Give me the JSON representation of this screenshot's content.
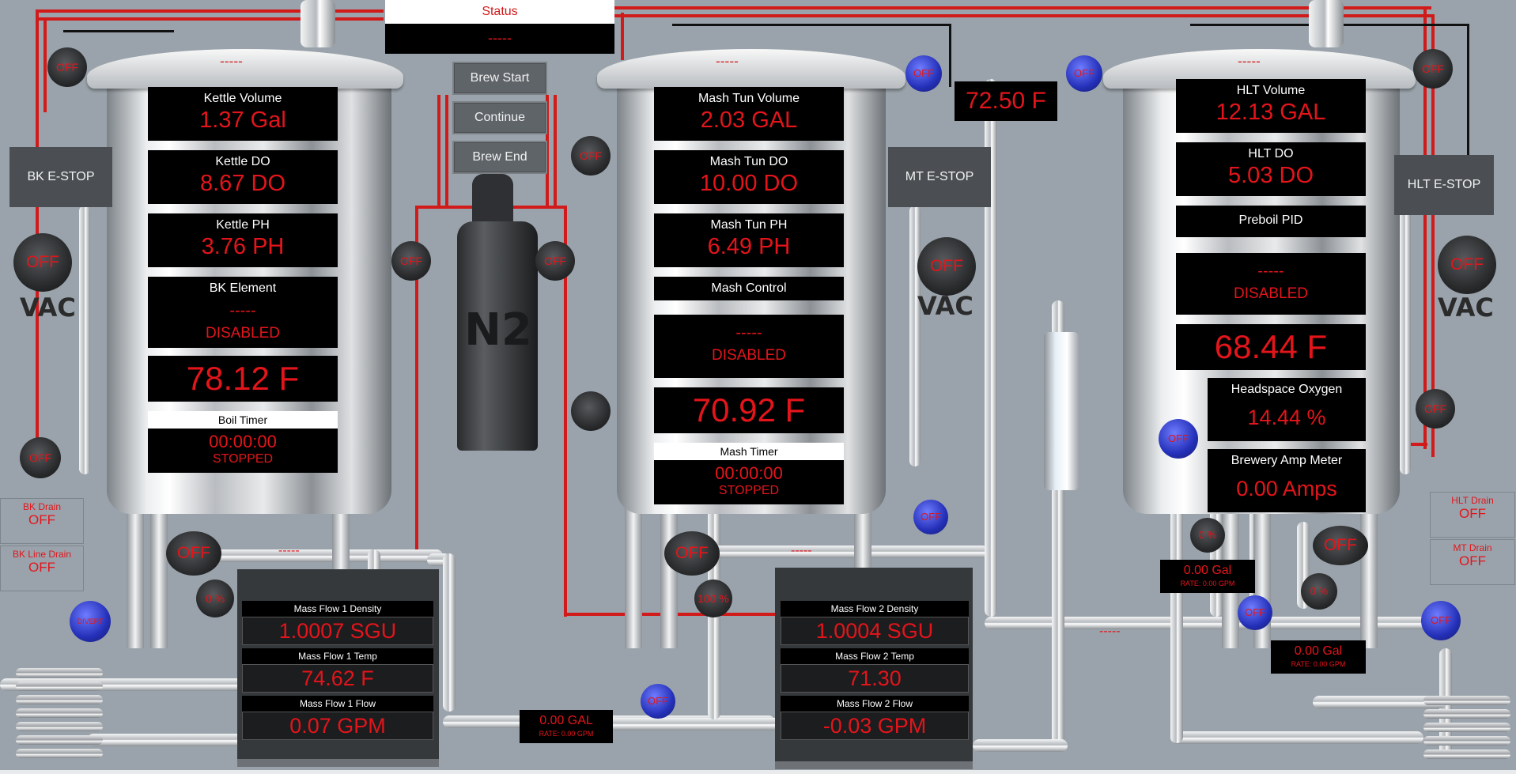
{
  "status": {
    "title": "Status",
    "value": "-----"
  },
  "controls": {
    "brew_start": "Brew Start",
    "continue": "Continue",
    "brew_end": "Brew End"
  },
  "n2_label": "N2",
  "kettle": {
    "lid_dash": "-----",
    "volume": {
      "label": "Kettle Volume",
      "value": "1.37 Gal"
    },
    "do": {
      "label": "Kettle DO",
      "value": "8.67 DO"
    },
    "ph": {
      "label": "Kettle  PH",
      "value": "3.76 PH"
    },
    "element": {
      "label": "BK Element",
      "dash": "-----",
      "state": "DISABLED"
    },
    "temp": "78.12 F",
    "timer": {
      "label": "Boil Timer",
      "time": "00:00:00",
      "state": "STOPPED"
    },
    "estop": "BK E-STOP",
    "outlet_dash": "-----"
  },
  "mash": {
    "lid_dash": "-----",
    "volume": {
      "label": "Mash Tun Volume",
      "value": "2.03 GAL"
    },
    "do": {
      "label": "Mash Tun DO",
      "value": "10.00 DO"
    },
    "ph": {
      "label": "Mash Tun PH",
      "value": "6.49 PH"
    },
    "control": {
      "label": "Mash Control",
      "dash": "-----",
      "state": "DISABLED"
    },
    "temp": "70.92 F",
    "timer": {
      "label": "Mash Timer",
      "time": "00:00:00",
      "state": "STOPPED"
    },
    "estop": "MT E-STOP",
    "outlet_dash": "-----"
  },
  "hlt": {
    "lid_dash": "-----",
    "volume": {
      "label": "HLT Volume",
      "value": "12.13 GAL"
    },
    "do": {
      "label": "HLT DO",
      "value": "5.03 DO"
    },
    "pid": {
      "label": "Preboil PID",
      "dash": "-----",
      "state": "DISABLED"
    },
    "temp": "68.44 F",
    "headspace": {
      "label": "Headspace Oxygen",
      "value": "14.44 %"
    },
    "amp": {
      "label": "Brewery Amp Meter",
      "value": "0.00 Amps"
    },
    "estop": "HLT E-STOP",
    "outlet_dash": "-----"
  },
  "transfer_temp": "72.50 F",
  "vac_label": "VAC",
  "off": "OFF",
  "pumps": {
    "bk_top": "OFF",
    "bk_vac": "OFF",
    "bk_bottom": "OFF",
    "bk_outlet": "OFF",
    "bk_pct": "0 %",
    "n2_left": "OFF",
    "n2_right": "OFF",
    "mt_left_top": "OFF",
    "mt_vac": "OFF",
    "mt_outlet": "OFF",
    "mt_pct": "100 %",
    "hlt_top": "OFF",
    "hlt_vac": "OFF",
    "hlt_side": "OFF",
    "hlt_outlet": "OFF",
    "hlt_pct1": "0 %",
    "hlt_pct2": "0 %"
  },
  "valves": {
    "mt_top_left": "OFF",
    "mt_top_right": "OFF",
    "mt_bottom": "OFF",
    "center_bottom": "OFF",
    "hlt_left": "OFF",
    "hlt_mid": "OFF",
    "hlt_right": "OFF"
  },
  "drains": {
    "bk_drain": {
      "label": "BK Drain",
      "value": "OFF"
    },
    "bk_line_drain": {
      "label": "BK Line Drain",
      "value": "OFF"
    },
    "hlt_drain": {
      "label": "HLT Drain",
      "value": "OFF"
    },
    "mt_drain": {
      "label": "MT Drain",
      "value": "OFF"
    }
  },
  "mass_flow_1": {
    "density": {
      "label": "Mass Flow 1 Density",
      "value": "1.0007 SGU"
    },
    "temp": {
      "label": "Mass Flow 1 Temp",
      "value": "74.62 F"
    },
    "flow": {
      "label": "Mass Flow 1 Flow",
      "value": "0.07 GPM"
    }
  },
  "mass_flow_2": {
    "density": {
      "label": "Mass Flow 2 Density",
      "value": "1.0004 SGU"
    },
    "temp": {
      "label": "Mass Flow 2 Temp",
      "value": "71.30"
    },
    "flow": {
      "label": "Mass Flow 2 Flow",
      "value": "-0.03 GPM"
    }
  },
  "gal_center": {
    "value": "0.00 GAL",
    "rate": "RATE: 0.00 GPM"
  },
  "gal_hlt_1": {
    "value": "0.00 Gal",
    "rate": "RATE: 0.00 GPM"
  },
  "gal_hlt_2": {
    "value": "0.00 Gal",
    "rate": "RATE: 0.00 GPM"
  },
  "hlt_line_dash": "-----",
  "bk_blue_valve_label": "DIVERT"
}
